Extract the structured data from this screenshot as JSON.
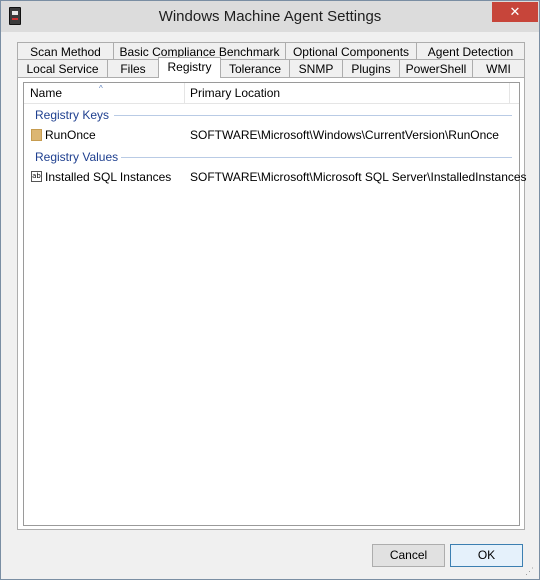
{
  "window": {
    "title": "Windows Machine Agent Settings",
    "close_glyph": "✕"
  },
  "tabs": {
    "row1": [
      "Scan Method",
      "Basic Compliance Benchmark",
      "Optional Components",
      "Agent Detection"
    ],
    "row2": [
      "Local Service",
      "Files",
      "Registry",
      "Tolerance",
      "SNMP",
      "Plugins",
      "PowerShell",
      "WMI"
    ],
    "active": "Registry"
  },
  "list": {
    "columns": [
      "Name",
      "Primary Location"
    ],
    "sort_glyph": "^",
    "groups": [
      {
        "label": "Registry Keys",
        "icon": "folder-icon",
        "rows": [
          {
            "name": "RunOnce",
            "location": "SOFTWARE\\Microsoft\\Windows\\CurrentVersion\\RunOnce"
          }
        ]
      },
      {
        "label": "Registry Values",
        "icon": "string-value-icon",
        "icon_text": "ab",
        "rows": [
          {
            "name": "Installed SQL Instances",
            "location": "SOFTWARE\\Microsoft\\Microsoft SQL Server\\InstalledInstances"
          }
        ]
      }
    ]
  },
  "buttons": {
    "cancel": "Cancel",
    "ok": "OK"
  },
  "colors": {
    "group_header": "#1e3f8f",
    "close_button": "#c7453a",
    "default_button_border": "#3c7fb1"
  }
}
